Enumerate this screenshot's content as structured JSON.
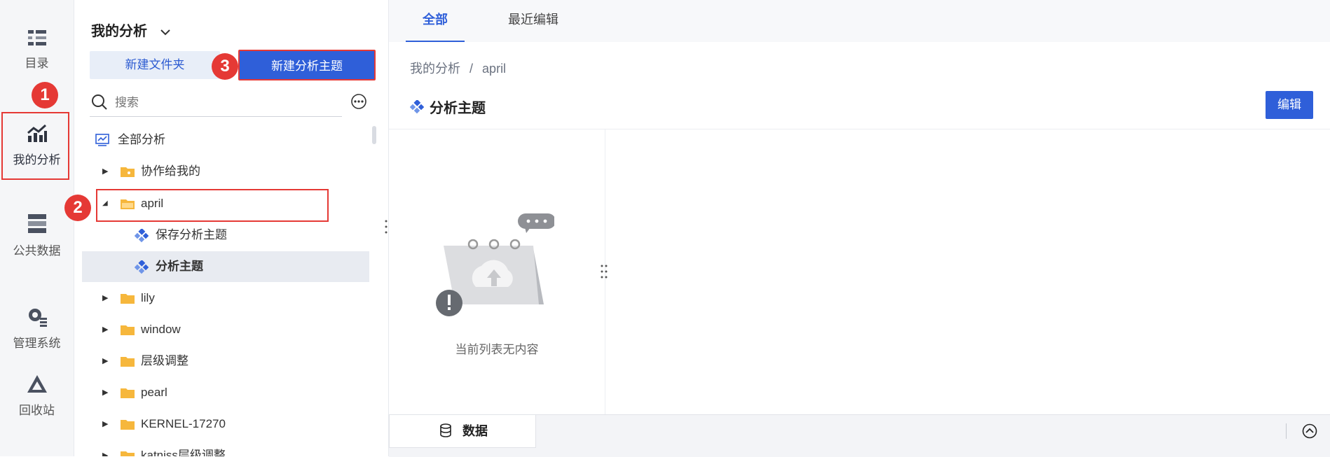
{
  "rail": {
    "catalog_label": "目录",
    "mine_label": "我的分析",
    "public_label": "公共数据",
    "admin_label": "管理系统",
    "trash_label": "回收站"
  },
  "markers": {
    "m1": "1",
    "m2": "2",
    "m3": "3"
  },
  "tree": {
    "title": "我的分析",
    "new_folder_label": "新建文件夹",
    "new_topic_label": "新建分析主题",
    "search_placeholder": "搜索",
    "items": [
      {
        "label": "全部分析"
      },
      {
        "label": "协作给我的"
      },
      {
        "label": "april"
      },
      {
        "label": "保存分析主题"
      },
      {
        "label": "分析主题"
      },
      {
        "label": "lily"
      },
      {
        "label": "window"
      },
      {
        "label": "层级调整"
      },
      {
        "label": "pearl"
      },
      {
        "label": "KERNEL-17270"
      },
      {
        "label": "katniss层级调整"
      }
    ]
  },
  "tabs": [
    {
      "label": "全部"
    },
    {
      "label": "最近编辑"
    }
  ],
  "main": {
    "breadcrumb_root": "我的分析",
    "breadcrumb_sep": "/",
    "breadcrumb_current": "april",
    "topic_title": "分析主题",
    "edit_label": "编辑",
    "empty_text": "当前列表无内容",
    "data_tab_label": "数据"
  },
  "colors": {
    "accent": "#2f5fd9",
    "highlight": "#e53935",
    "folder": "#f6b73c"
  }
}
